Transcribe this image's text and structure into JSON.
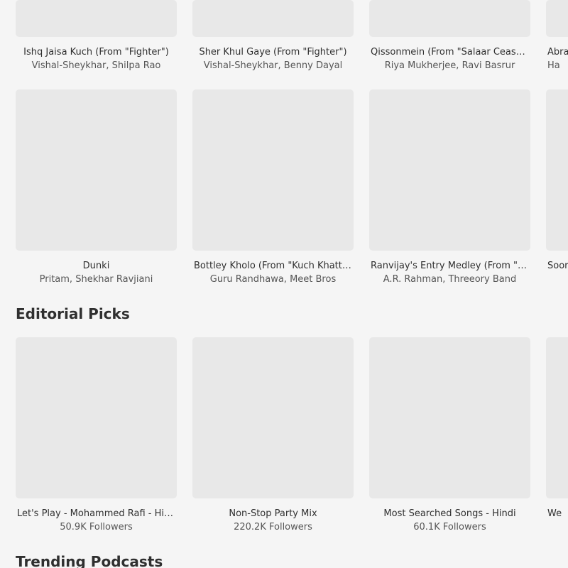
{
  "row_top": [
    {
      "title": "Ishq Jaisa Kuch (From \"Fighter\")",
      "subtitle": "Vishal-Sheykhar, Shilpa Rao"
    },
    {
      "title": "Sher Khul Gaye (From \"Fighter\")",
      "subtitle": "Vishal-Sheykhar, Benny Dayal"
    },
    {
      "title": "Qissonmein (From \"Salaar Cease Fire - ...",
      "subtitle": "Riya Mukherjee, Ravi Basrur"
    },
    {
      "title": "Abrar",
      "subtitle": "Ha"
    }
  ],
  "row_middle": [
    {
      "title": "Dunki",
      "subtitle": "Pritam, Shekhar Ravjiani"
    },
    {
      "title": "Bottley Kholo (From \"Kuch Khattaa ...",
      "subtitle": "Guru Randhawa, Meet Bros"
    },
    {
      "title": "Ranvijay's Entry Medley (From \"ANI...",
      "subtitle": "A.R. Rahman, Threeory Band"
    },
    {
      "title": "Soora",
      "subtitle": ""
    }
  ],
  "editorial_picks": {
    "heading": "Editorial Picks",
    "items": [
      {
        "title": "Let's Play - Mohammed Rafi - Hindi",
        "subtitle": "50.9K Followers"
      },
      {
        "title": "Non-Stop Party Mix",
        "subtitle": "220.2K Followers"
      },
      {
        "title": "Most Searched Songs - Hindi",
        "subtitle": "60.1K Followers"
      },
      {
        "title": "We",
        "subtitle": ""
      }
    ]
  },
  "trending_podcasts": {
    "heading": "Trending Podcasts"
  }
}
